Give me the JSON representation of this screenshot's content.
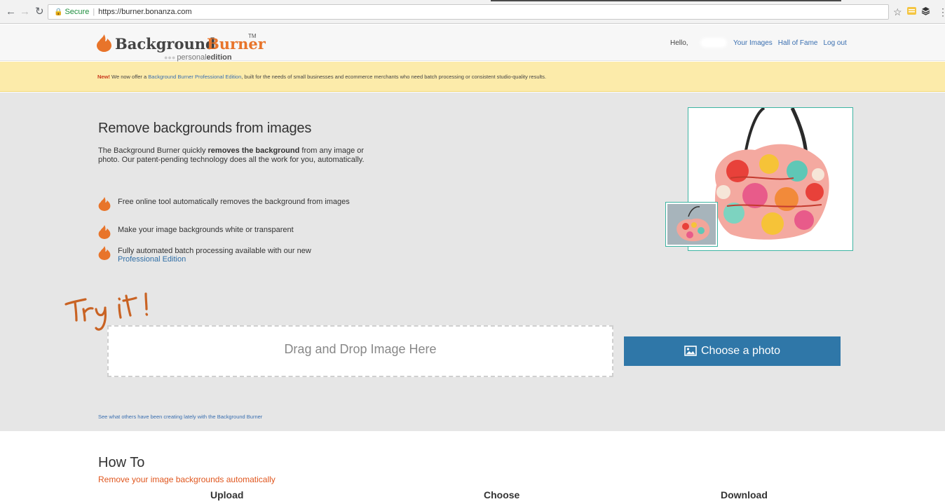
{
  "browser": {
    "url": "https://burner.bonanza.com",
    "secure_label": "Secure"
  },
  "header": {
    "logo_word1": "Background",
    "logo_word2": "Burner",
    "logo_tm": "TM",
    "logo_edition_prefix": "personal",
    "logo_edition_bold": "edition",
    "hello_label": "Hello,",
    "nav": [
      {
        "label": "Your Images"
      },
      {
        "label": "Hall of Fame"
      },
      {
        "label": "Log out"
      }
    ]
  },
  "banner": {
    "new_label": "New!",
    "text_before": " We now offer a ",
    "link_text": "Background Burner Professional Edition",
    "text_after": ", built for the needs of small businesses and ecommerce merchants who need batch processing or consistent studio-quality results."
  },
  "hero": {
    "title": "Remove backgrounds from images",
    "desc_before": "The Background Burner quickly ",
    "desc_bold": "removes the background",
    "desc_after": " from any image or photo. Our patent-pending technology does all the work for you, automatically.",
    "features": [
      {
        "text": "Free online tool automatically removes the background from images"
      },
      {
        "text": "Make your image backgrounds white or transparent"
      },
      {
        "text": "Fully automated batch processing available with our new",
        "link": "Professional Edition"
      }
    ],
    "try_it": "Try it!",
    "dropzone_label": "Drag and Drop Image Here",
    "choose_button": "Choose a photo",
    "see_others_link": "See what others have been creating lately with the Background Burner"
  },
  "howto": {
    "title": "How To",
    "subtitle": "Remove your image backgrounds automatically",
    "steps": [
      "Upload",
      "Choose",
      "Download"
    ]
  },
  "colors": {
    "accent_orange": "#e8742a",
    "button_blue": "#2f77a8",
    "banner_yellow": "#fcebaa",
    "frame_teal": "#3db4a2"
  }
}
